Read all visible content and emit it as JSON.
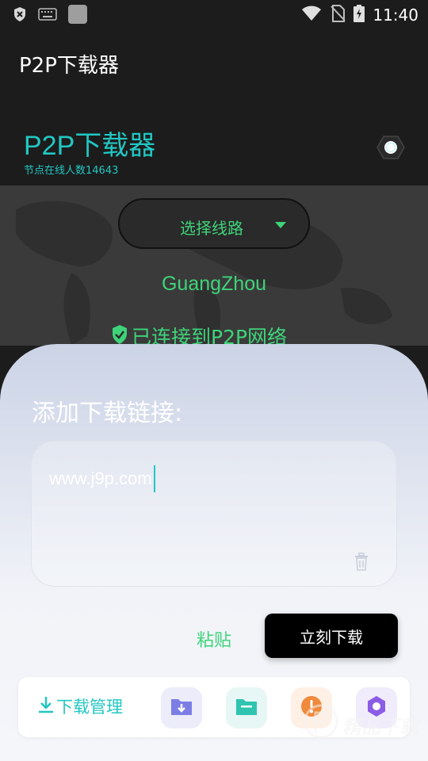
{
  "status_bar": {
    "time": "11:40",
    "icons": [
      "shield-x-icon",
      "keyboard-icon",
      "app-square-icon",
      "wifi-icon",
      "no-sim-icon",
      "battery-charging-icon"
    ]
  },
  "app_bar": {
    "title": "P2P下载器"
  },
  "header": {
    "title": "P2P下载器",
    "node_count": "节点在线人数14643",
    "status_icon": "connection-status-icon"
  },
  "map": {
    "route_select": {
      "label": "选择线路",
      "icon": "dropdown-arrow-icon"
    },
    "location": "GuangZhou",
    "connected_text": "已连接到P2P网络"
  },
  "sheet": {
    "title": "添加下载链接:",
    "url_value": "www.j9p.com",
    "clear_icon": "trash-icon",
    "paste_label": "粘贴",
    "download_label": "立刻下载"
  },
  "bottom_nav": {
    "manage_label": "下载管理",
    "items": [
      "folder-download-icon",
      "folder-icon",
      "alert-icon",
      "settings-icon"
    ]
  },
  "watermark": {
    "text": "精品下载"
  },
  "colors": {
    "accent_cyan": "#21c7c3",
    "accent_green": "#3ed47a",
    "dark_bg": "#1c1c1c"
  }
}
